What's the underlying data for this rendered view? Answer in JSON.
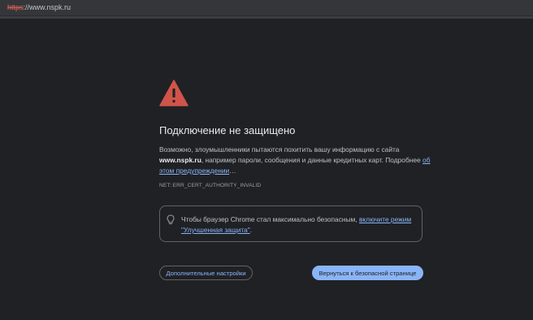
{
  "address_bar": {
    "scheme": "https",
    "rest": "://www.nspk.ru"
  },
  "icons": {
    "warning": "warning-triangle-icon",
    "bulb": "lightbulb-icon"
  },
  "colors": {
    "warning_red": "#d1544a",
    "link_blue": "#8ab4f8",
    "background": "#202124"
  },
  "interstitial": {
    "title": "Подключение не защищено",
    "desc_part1": "Возможно, злоумышленники пытаются похитить вашу информацию с сайта ",
    "desc_host": "www.nspk.ru",
    "desc_part2": ", например пароли, сообщения и данные кредитных карт. Подробнее ",
    "desc_link": "об этом предупреждении",
    "desc_ellipsis": "…",
    "error_code": "NET::ERR_CERT_AUTHORITY_INVALID",
    "card_text": "Чтобы браузер Chrome стал максимально безопасным, ",
    "card_link": "включите режим \"Улучшенная защита\"",
    "card_end": ".",
    "advanced_button": "Дополнительные настройки",
    "back_button": "Вернуться к безопасной странице"
  }
}
